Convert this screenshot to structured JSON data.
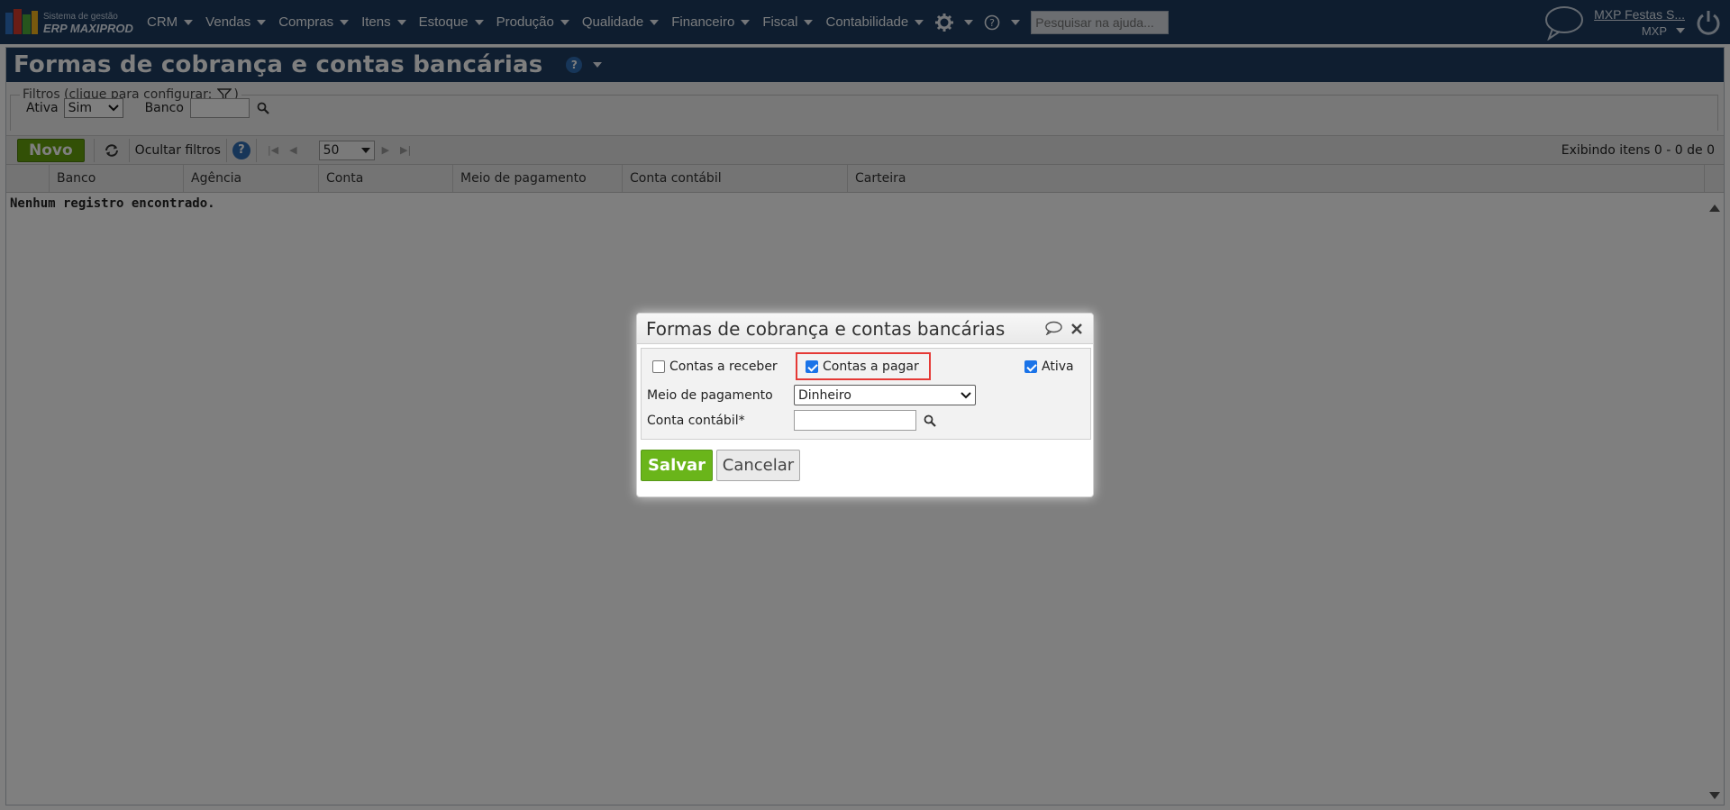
{
  "app": {
    "logo_sub": "Sistema de gestão",
    "logo_main": "ERP MAXIPROD",
    "menu": [
      {
        "label": "CRM"
      },
      {
        "label": "Vendas"
      },
      {
        "label": "Compras"
      },
      {
        "label": "Itens"
      },
      {
        "label": "Estoque"
      },
      {
        "label": "Produção"
      },
      {
        "label": "Qualidade"
      },
      {
        "label": "Financeiro"
      },
      {
        "label": "Fiscal"
      },
      {
        "label": "Contabilidade"
      }
    ],
    "search_placeholder": "Pesquisar na ajuda...",
    "user_name": "MXP Festas S...",
    "company": "MXP"
  },
  "page": {
    "title": "Formas de cobrança e contas bancárias",
    "help_icon": "?"
  },
  "filters": {
    "legend": "Filtros (clique para configurar:",
    "legend_close": ")",
    "ativa_label": "Ativa",
    "ativa_value": "Sim",
    "banco_label": "Banco",
    "banco_value": ""
  },
  "toolbar": {
    "novo_label": "Novo",
    "hide_filters_label": "Ocultar filtros",
    "page_size": "50",
    "pager_info": "Exibindo itens 0 - 0 de 0"
  },
  "grid": {
    "columns": [
      "Banco",
      "Agência",
      "Conta",
      "Meio de pagamento",
      "Conta contábil",
      "Carteira"
    ],
    "empty_message": "Nenhum registro encontrado."
  },
  "dialog": {
    "title": "Formas de cobrança e contas bancárias",
    "contas_receber_label": "Contas a receber",
    "contas_receber_checked": false,
    "contas_pagar_label": "Contas a pagar",
    "contas_pagar_checked": true,
    "ativa_label": "Ativa",
    "ativa_checked": true,
    "meio_pagamento_label": "Meio de pagamento",
    "meio_pagamento_value": "Dinheiro",
    "conta_contabil_label": "Conta contábil*",
    "conta_contabil_value": "",
    "save_label": "Salvar",
    "cancel_label": "Cancelar"
  },
  "colors": {
    "topbar": "#1c3a5e",
    "accent_green": "#64a10c",
    "highlight_red": "#e53935"
  }
}
